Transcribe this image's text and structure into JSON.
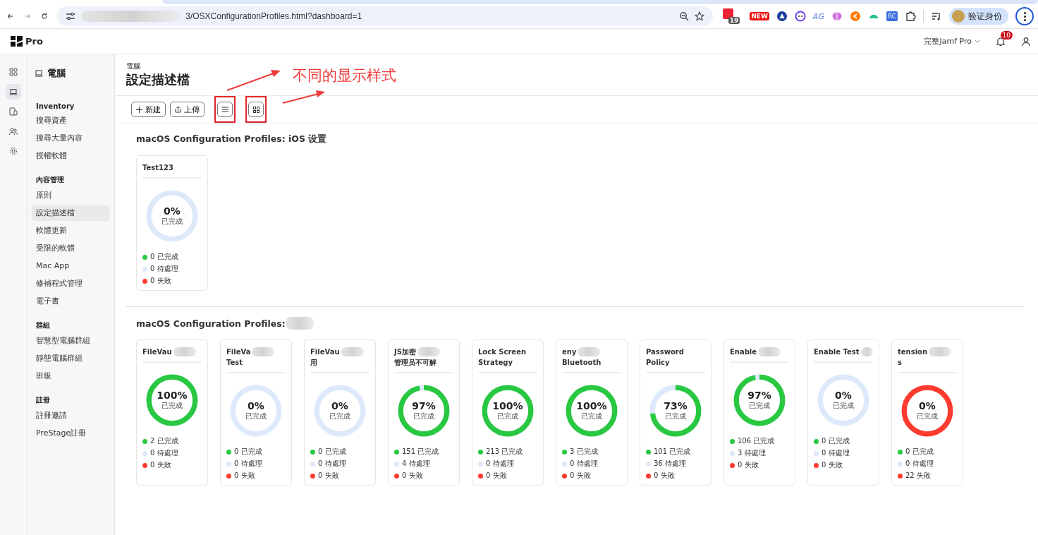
{
  "browser": {
    "url": "3/OSXConfigurationProfiles.html?dashboard=1",
    "extensions": [
      {
        "kind": "calendar",
        "badge": "19"
      },
      {
        "kind": "new",
        "badge": "NEW"
      },
      {
        "kind": "triangle"
      },
      {
        "kind": "face"
      },
      {
        "kind": "ag",
        "badge": "AG"
      },
      {
        "kind": "brain"
      },
      {
        "kind": "orange"
      },
      {
        "kind": "cloud"
      },
      {
        "kind": "rc",
        "badge": "RC"
      },
      {
        "kind": "puzzle"
      }
    ],
    "profile": "验证身份"
  },
  "app": {
    "logo": "Pro",
    "instance": "完整Jamf Pro",
    "notifications": "10"
  },
  "rail": [
    {
      "kind": "dashboard",
      "selected": false
    },
    {
      "kind": "computer",
      "selected": true
    },
    {
      "kind": "devices",
      "selected": false
    },
    {
      "kind": "users",
      "selected": false
    },
    {
      "kind": "settings",
      "selected": false
    }
  ],
  "sidebar": {
    "title": "電腦",
    "groups": [
      {
        "heading": "Inventory",
        "items": [
          {
            "label": "搜尋資產",
            "selected": false
          },
          {
            "label": "搜尋大量內容",
            "selected": false
          },
          {
            "label": "授權軟體",
            "selected": false
          }
        ]
      },
      {
        "heading": "內容管理",
        "items": [
          {
            "label": "原則",
            "selected": false
          },
          {
            "label": "設定描述檔",
            "selected": true
          },
          {
            "label": "軟體更新",
            "selected": false
          },
          {
            "label": "受限的軟體",
            "selected": false
          },
          {
            "label": "Mac App",
            "selected": false
          },
          {
            "label": "修補程式管理",
            "selected": false
          },
          {
            "label": "電子書",
            "selected": false
          }
        ]
      },
      {
        "heading": "群組",
        "items": [
          {
            "label": "智慧型電腦群組",
            "selected": false
          },
          {
            "label": "靜態電腦群組",
            "selected": false
          },
          {
            "label": "班級",
            "selected": false
          }
        ]
      },
      {
        "heading": "註冊",
        "items": [
          {
            "label": "註冊邀請",
            "selected": false
          },
          {
            "label": "PreStage註冊",
            "selected": false
          }
        ]
      }
    ]
  },
  "page": {
    "breadcrumb": "電腦",
    "title": "設定描述檔"
  },
  "toolbar": [
    {
      "kind": "new",
      "label": "新建"
    },
    {
      "kind": "upload",
      "label": "上傳"
    },
    {
      "kind": "list"
    },
    {
      "kind": "grid"
    }
  ],
  "annotation": {
    "text": "不同的显示样式"
  },
  "sections": [
    {
      "title": "macOS Configuration Profiles: iOS 设置",
      "cards": [
        {
          "title": [
            "Test123"
          ],
          "kind": "normal",
          "percent": "0%",
          "caption": "已完成",
          "stats": [
            "0 已完成",
            "0 待處理",
            "0 失敗"
          ]
        }
      ]
    },
    {
      "title": "macOS Configuration Profiles:",
      "redacted": true,
      "cards": [
        {
          "title": [
            "FileVau"
          ],
          "redacted": true,
          "kind": "normal",
          "percent": "100%",
          "caption": "已完成",
          "stats": [
            "2 已完成",
            "0 待處理",
            "0 失敗"
          ]
        },
        {
          "title": [
            "FileVa",
            "Test"
          ],
          "redacted": true,
          "kind": "normal",
          "percent": "0%",
          "caption": "已完成",
          "stats": [
            "0 已完成",
            "0 待處理",
            "0 失敗"
          ]
        },
        {
          "title": [
            "FileVau",
            "用"
          ],
          "redacted": true,
          "kind": "normal",
          "percent": "0%",
          "caption": "已完成",
          "stats": [
            "0 已完成",
            "0 待處理",
            "0 失敗"
          ]
        },
        {
          "title": [
            "JS加密",
            "管理员不可解"
          ],
          "redacted": true,
          "kind": "normal",
          "percent": "97%",
          "caption": "已完成",
          "stats": [
            "151 已完成",
            "4 待處理",
            "0 失敗"
          ]
        },
        {
          "title": [
            "Lock Screen",
            "Strategy"
          ],
          "kind": "normal",
          "percent": "100%",
          "caption": "已完成",
          "stats": [
            "213 已完成",
            "0 待處理",
            "0 失敗"
          ]
        },
        {
          "title": [
            "eny",
            "Bluetooth"
          ],
          "redacted": true,
          "kind": "normal",
          "percent": "100%",
          "caption": "已完成",
          "stats": [
            "3 已完成",
            "0 待處理",
            "0 失敗"
          ]
        },
        {
          "title": [
            "Password",
            "Policy"
          ],
          "kind": "normal",
          "percent": "73%",
          "caption": "已完成",
          "stats": [
            "101 已完成",
            "36 待處理",
            "0 失敗"
          ]
        },
        {
          "title": [
            "Enable"
          ],
          "redacted": true,
          "kind": "normal",
          "percent": "97%",
          "caption": "已完成",
          "stats": [
            "106 已完成",
            "3 待處理",
            "0 失敗"
          ]
        },
        {
          "title": [
            "Enable Test"
          ],
          "redacted": true,
          "kind": "normal",
          "percent": "0%",
          "caption": "已完成",
          "stats": [
            "0 已完成",
            "0 待處理",
            "0 失敗"
          ]
        },
        {
          "title": [
            "tension",
            "s"
          ],
          "redacted": true,
          "kind": "failed",
          "percent": "0%",
          "caption": "已完成",
          "stats": [
            "0 已完成",
            "0 待處理",
            "22 失敗"
          ]
        }
      ]
    }
  ]
}
